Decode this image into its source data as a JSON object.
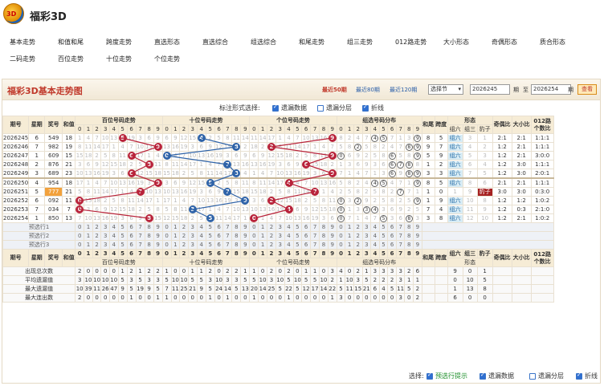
{
  "app": {
    "title": "福彩3D",
    "logo_text": "3D"
  },
  "nav": {
    "row1": [
      "基本走势",
      "和值和尾",
      "跨度走势",
      "直选形态",
      "直选综合",
      "组选综合",
      "和尾走势",
      "组三走势",
      "012路走势",
      "大小形态",
      "奇偶形态",
      "质合形态"
    ],
    "row2": [
      "二码走势",
      "百位走势",
      "十位走势",
      "个位走势"
    ]
  },
  "panel": {
    "title": "福彩3D基本走势图",
    "recent50": "最近50期",
    "recent80": "最近80期",
    "recent120": "最近120期",
    "select_label": "选择节",
    "from_value": "2026245",
    "from_unit": "期",
    "to_label": "至",
    "to_value": "2026254",
    "to_unit": "期",
    "query_btn": "查看"
  },
  "options": {
    "label": "标注形式选择:",
    "items": [
      {
        "label": "遗漏数据",
        "checked": true
      },
      {
        "label": "遗漏分层",
        "checked": false
      },
      {
        "label": "折线",
        "checked": true
      }
    ]
  },
  "table": {
    "head_top": [
      "期号",
      "星期",
      "奖号",
      "和值",
      "百位号码走势",
      "十位号码走势",
      "个位号码走势",
      "组选号码分布",
      "和尾",
      "跨度",
      "形态",
      "奇偶比",
      "大小比",
      "012路"
    ],
    "head_top2": [
      "个数比"
    ],
    "xingtai_sub": [
      "组六",
      "组三",
      "豹子"
    ],
    "digits": [
      "0",
      "1",
      "2",
      "3",
      "4",
      "5",
      "6",
      "7",
      "8",
      "9"
    ],
    "rows": [
      {
        "issue": "2026245",
        "week": "6",
        "num": "549",
        "sum": "18",
        "h": "5",
        "t": "4",
        "g": "9",
        "hw": "8",
        "kd": "5",
        "xt": "组六",
        "jo": "2:1",
        "dx": "2:1",
        "lu": "1:1:1"
      },
      {
        "issue": "2026246",
        "week": "7",
        "num": "982",
        "sum": "19",
        "h": "9",
        "t": "8",
        "g": "2",
        "hw": "9",
        "kd": "7",
        "xt": "组六",
        "jo": "1:2",
        "dx": "2:1",
        "lu": "1:1:1"
      },
      {
        "issue": "2026247",
        "week": "1",
        "num": "609",
        "sum": "15",
        "h": "6",
        "t": "0",
        "g": "9",
        "hw": "5",
        "kd": "9",
        "xt": "组六",
        "jo": "1:2",
        "dx": "2:1",
        "lu": "3:0:0"
      },
      {
        "issue": "2026248",
        "week": "2",
        "num": "876",
        "sum": "21",
        "h": "8",
        "t": "7",
        "g": "6",
        "hw": "1",
        "kd": "2",
        "xt": "组六",
        "jo": "1:2",
        "dx": "3:0",
        "lu": "1:1:1"
      },
      {
        "issue": "2026249",
        "week": "3",
        "num": "689",
        "sum": "23",
        "h": "6",
        "t": "8",
        "g": "9",
        "hw": "3",
        "kd": "3",
        "xt": "组六",
        "jo": "1:2",
        "dx": "3:0",
        "lu": "2:0:1"
      },
      {
        "issue": "2026250",
        "week": "4",
        "num": "954",
        "sum": "18",
        "h": "9",
        "t": "5",
        "g": "4",
        "hw": "8",
        "kd": "5",
        "xt": "组六",
        "jo": "2:1",
        "dx": "2:1",
        "lu": "1:1:1"
      },
      {
        "issue": "2026251",
        "week": "5",
        "num": "777",
        "sum": "21",
        "h": "7",
        "t": "7",
        "g": "7",
        "hw": "1",
        "kd": "0",
        "xt": "豹子",
        "jo": "3:0",
        "dx": "3:0",
        "lu": "0:3:0"
      },
      {
        "issue": "2026252",
        "week": "6",
        "num": "092",
        "sum": "11",
        "h": "0",
        "t": "9",
        "g": "2",
        "hw": "1",
        "kd": "9",
        "xt": "组六",
        "jo": "1:2",
        "dx": "1:2",
        "lu": "1:0:2"
      },
      {
        "issue": "2026253",
        "week": "7",
        "num": "034",
        "sum": "7",
        "h": "0",
        "t": "3",
        "g": "4",
        "hw": "7",
        "kd": "4",
        "xt": "组六",
        "jo": "1:2",
        "dx": "0:3",
        "lu": "2:1:0"
      },
      {
        "issue": "2026254",
        "week": "1",
        "num": "850",
        "sum": "13",
        "h": "8",
        "t": "5",
        "g": "0",
        "hw": "3",
        "kd": "8",
        "xt": "组六",
        "jo": "1:2",
        "dx": "2:1",
        "lu": "1:0:2"
      }
    ],
    "pred_rows": [
      "预选行1",
      "预选行2",
      "预选行3"
    ],
    "bottom_head": [
      "期号",
      "星期",
      "奖号",
      "和值",
      "百位号码走势",
      "十位号码走势",
      "个位号码走势",
      "组选号码分布",
      "和尾",
      "跨度",
      "形态",
      "奇偶比",
      "大小比",
      "012路"
    ],
    "stat_rows": [
      {
        "label": "出现总次数",
        "h": "2 0 0 0 0 1 2 1 2 2",
        "t": "1 0 0 1 1 2 0 2 2 1",
        "g": "1 0 2 0 2 0 1 1 0 3",
        "z": "4 0 2 1 3 3 3 3 2 6",
        "x": "9 0 1"
      },
      {
        "label": "平均遗漏值",
        "h": "3 10 10 10 10 5 3 5 3 3",
        "t": "5 10 10 5 5 3 10 3 3 5",
        "g": "5 10 3 10 5 10 5 5 10 2",
        "z": "1 10 3 5 2 2 2 3 1 1",
        "x": "0 10 5"
      },
      {
        "label": "最大遗漏值",
        "h": "10 39 11 26 47 9 5 19 9 5",
        "t": "7 11 25 21 9 5 24 14 5 13",
        "g": "20 14 25 5 22 5 12 17 14 22",
        "z": "5 11 15 21 6 4 5 11 5 2",
        "x": "1 13 8"
      },
      {
        "label": "最大连出数",
        "h": "2 0 0 0 0 0 1 0 0 1",
        "t": "1 0 0 0 0 1 0 1 0 0",
        "g": "1 0 0 0 1 0 0 0 0 1",
        "z": "3 0 0 0 0 0 0 3 0 2",
        "x": "6 0 0"
      }
    ]
  },
  "footer": {
    "label": "选择:",
    "items": [
      {
        "label": "预选行提示",
        "checked": true
      },
      {
        "label": "遗漏数据",
        "checked": true
      },
      {
        "label": "遗漏分层",
        "checked": false
      },
      {
        "label": "折线",
        "checked": true
      }
    ]
  }
}
